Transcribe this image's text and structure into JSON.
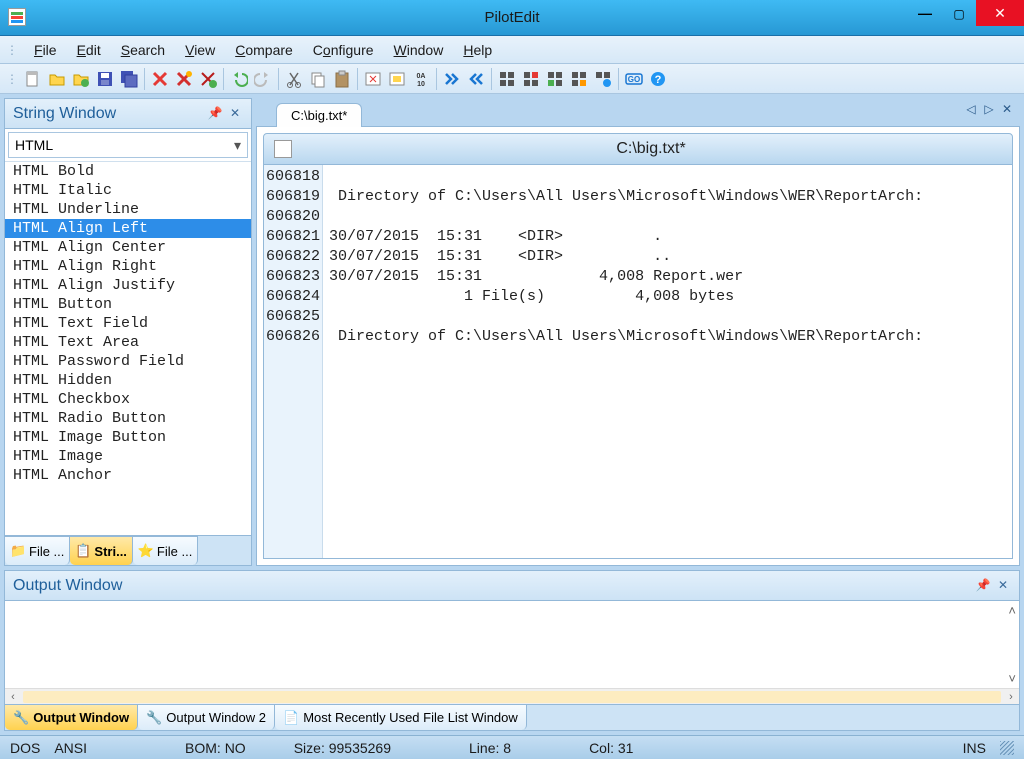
{
  "app": {
    "title": "PilotEdit"
  },
  "menu": {
    "items": [
      {
        "label": "File",
        "accel": "F"
      },
      {
        "label": "Edit",
        "accel": "E"
      },
      {
        "label": "Search",
        "accel": "S"
      },
      {
        "label": "View",
        "accel": "V"
      },
      {
        "label": "Compare",
        "accel": "C"
      },
      {
        "label": "Configure",
        "accel": "o"
      },
      {
        "label": "Window",
        "accel": "W"
      },
      {
        "label": "Help",
        "accel": "H"
      }
    ]
  },
  "toolbar": {
    "groups": [
      [
        "new-file",
        "open-file",
        "open-ftp",
        "save",
        "save-all"
      ],
      [
        "delete-x",
        "delete-red-x",
        "add-green"
      ],
      [
        "undo",
        "redo"
      ],
      [
        "cut",
        "copy",
        "paste"
      ],
      [
        "toggle-1",
        "toggle-2",
        "hex-0a10"
      ],
      [
        "dbl-arrow-right",
        "dbl-arrow-left"
      ],
      [
        "grid-1",
        "grid-2",
        "grid-3",
        "grid-4",
        "grid-settings"
      ],
      [
        "go",
        "help"
      ]
    ]
  },
  "left_panel": {
    "title": "String Window",
    "dropdown": "HTML",
    "items": [
      "HTML Bold",
      "HTML Italic",
      "HTML Underline",
      "HTML Align Left",
      "HTML Align Center",
      "HTML Align Right",
      "HTML Align Justify",
      "HTML Button",
      "HTML Text Field",
      "HTML Text Area",
      "HTML Password Field",
      "HTML Hidden",
      "HTML Checkbox",
      "HTML Radio Button",
      "HTML Image Button",
      "HTML Image",
      "HTML Anchor"
    ],
    "selected_index": 3,
    "tabs": [
      {
        "label": "File ...",
        "active": false
      },
      {
        "label": "Stri...",
        "active": true
      },
      {
        "label": "File ...",
        "active": false
      }
    ]
  },
  "editor": {
    "tab_label": "C:\\big.txt*",
    "title": "C:\\big.txt*",
    "line_numbers": [
      "606818",
      "606819",
      "606820",
      "606821",
      "606822",
      "606823",
      "606824",
      "606825",
      "606826"
    ],
    "lines": [
      "",
      " Directory of C:\\Users\\All Users\\Microsoft\\Windows\\WER\\ReportArch:",
      "",
      "30/07/2015  15:31    <DIR>          .",
      "30/07/2015  15:31    <DIR>          ..",
      "30/07/2015  15:31             4,008 Report.wer",
      "               1 File(s)          4,008 bytes",
      "",
      " Directory of C:\\Users\\All Users\\Microsoft\\Windows\\WER\\ReportArch:"
    ]
  },
  "output_panel": {
    "title": "Output Window",
    "tabs": [
      {
        "label": "Output Window",
        "active": true
      },
      {
        "label": "Output Window 2",
        "active": false
      },
      {
        "label": "Most Recently Used File List Window",
        "active": false
      }
    ]
  },
  "status": {
    "encoding1": "DOS",
    "encoding2": "ANSI",
    "bom": "BOM: NO",
    "size": "Size: 99535269",
    "line": "Line: 8",
    "col": "Col: 31",
    "mode": "INS"
  }
}
